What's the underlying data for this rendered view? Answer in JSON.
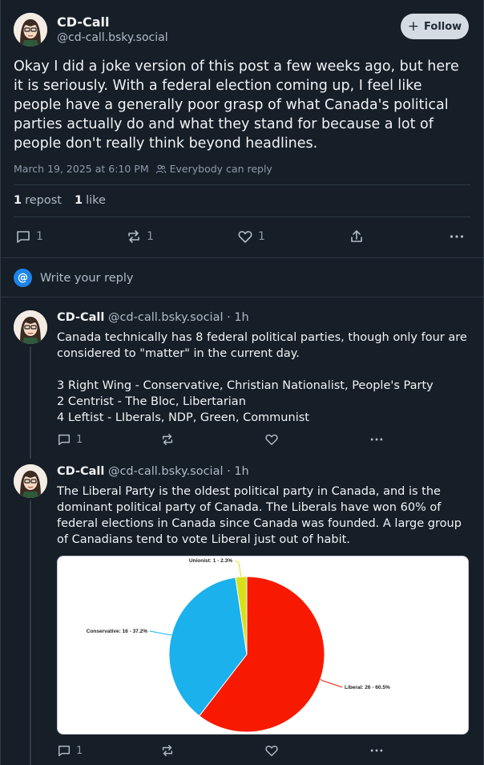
{
  "main_post": {
    "author_name": "CD-Call",
    "author_handle": "@cd-call.bsky.social",
    "follow_label": "Follow",
    "text": "Okay I did a joke version of this post a few weeks ago, but here it is seriously. With a federal election coming up, I feel like people have a generally poor grasp of what Canada's political parties actually do and what they stand for because a lot of people don't really think beyond headlines.",
    "timestamp": "March 19, 2025 at 6:10 PM",
    "reply_setting": "Everybody can reply",
    "repost_count": "1",
    "repost_label": "repost",
    "like_count": "1",
    "like_label": "like",
    "actions": {
      "replies": "1",
      "reposts": "1",
      "likes": "1"
    }
  },
  "reply_box": {
    "placeholder": "Write your reply",
    "icon": "@"
  },
  "replies": [
    {
      "author_name": "CD-Call",
      "author_handle": "@cd-call.bsky.social · 1h",
      "lines": [
        "Canada technically has 8 federal political parties, though only four are considered to \"matter\" in the current day.",
        "3 Right Wing - Conservative, Christian Nationalist, People's Party",
        "2 Centrist - The Bloc, Libertarian",
        "4 Leftist - LIberals, NDP, Green, Communist"
      ],
      "reply_count": "1"
    },
    {
      "author_name": "CD-Call",
      "author_handle": "@cd-call.bsky.social · 1h",
      "text": "The Liberal Party is the oldest political party in Canada, and is the dominant political party of Canada. The Liberals have won 60% of federal elections in Canada since Canada was founded. A large group of Canadians tend to vote Liberal just out of habit.",
      "reply_count": "1"
    }
  ],
  "colors": {
    "background": "#161e27",
    "accent": "#1d84ea",
    "liberal": "#f71a00",
    "conservative": "#1ab1ed",
    "unionist": "#d7e01a"
  },
  "chart_data": {
    "type": "pie",
    "slices": [
      {
        "name": "Liberal",
        "value": 26,
        "percent": 60.5,
        "label": "Liberal: 26 - 60.5%",
        "color": "#f71a00"
      },
      {
        "name": "Conservative",
        "value": 16,
        "percent": 37.2,
        "label": "Conservative: 16 - 37.2%",
        "color": "#1ab1ed"
      },
      {
        "name": "Unionist",
        "value": 1,
        "percent": 2.3,
        "label": "Unionist: 1 - 2.3%",
        "color": "#d7e01a"
      }
    ]
  }
}
